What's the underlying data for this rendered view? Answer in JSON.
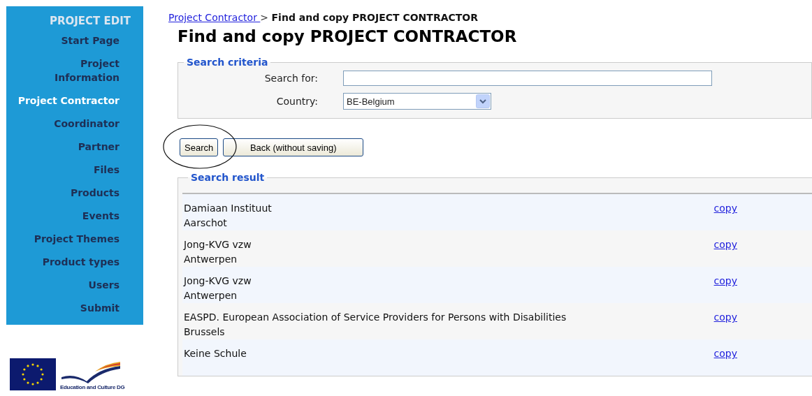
{
  "sidebar": {
    "title": "PROJECT EDIT",
    "items": [
      {
        "label": "Start Page",
        "selected": false
      },
      {
        "label": "Project Information",
        "selected": false
      },
      {
        "label": "Project Contractor",
        "selected": true
      },
      {
        "label": "Coordinator",
        "selected": false
      },
      {
        "label": "Partner",
        "selected": false
      },
      {
        "label": "Files",
        "selected": false
      },
      {
        "label": "Products",
        "selected": false
      },
      {
        "label": "Events",
        "selected": false
      },
      {
        "label": "Project Themes",
        "selected": false
      },
      {
        "label": "Product types",
        "selected": false
      },
      {
        "label": "Users",
        "selected": false
      },
      {
        "label": "Submit",
        "selected": false
      }
    ],
    "logo_caption": "Education and Culture DG"
  },
  "breadcrumb": {
    "link": "Project Contractor ",
    "separator": ">",
    "current": "Find and copy PROJECT CONTRACTOR"
  },
  "heading": "Find and copy PROJECT CONTRACTOR",
  "search_criteria": {
    "legend": "Search criteria",
    "search_label": "Search for:",
    "country_label": "Country:",
    "country_value": "BE-Belgium"
  },
  "buttons": [
    {
      "label": "Search",
      "highlighted": true
    },
    {
      "label": "Back (without saving)",
      "highlighted": false
    }
  ],
  "search_result": {
    "legend": "Search result",
    "rows": [
      {
        "name": "Damiaan Instituut",
        "city": "Aarschot",
        "action": "copy"
      },
      {
        "name": "Jong-KVG vzw",
        "city": "Antwerpen",
        "action": "copy"
      },
      {
        "name": "Jong-KVG vzw",
        "city": "Antwerpen",
        "action": "copy"
      },
      {
        "name": "EASPD. European Association of Service Providers for Persons with Disabilities",
        "city": "Brussels",
        "action": "copy"
      },
      {
        "name": "Keine Schule",
        "action": "copy"
      }
    ]
  }
}
